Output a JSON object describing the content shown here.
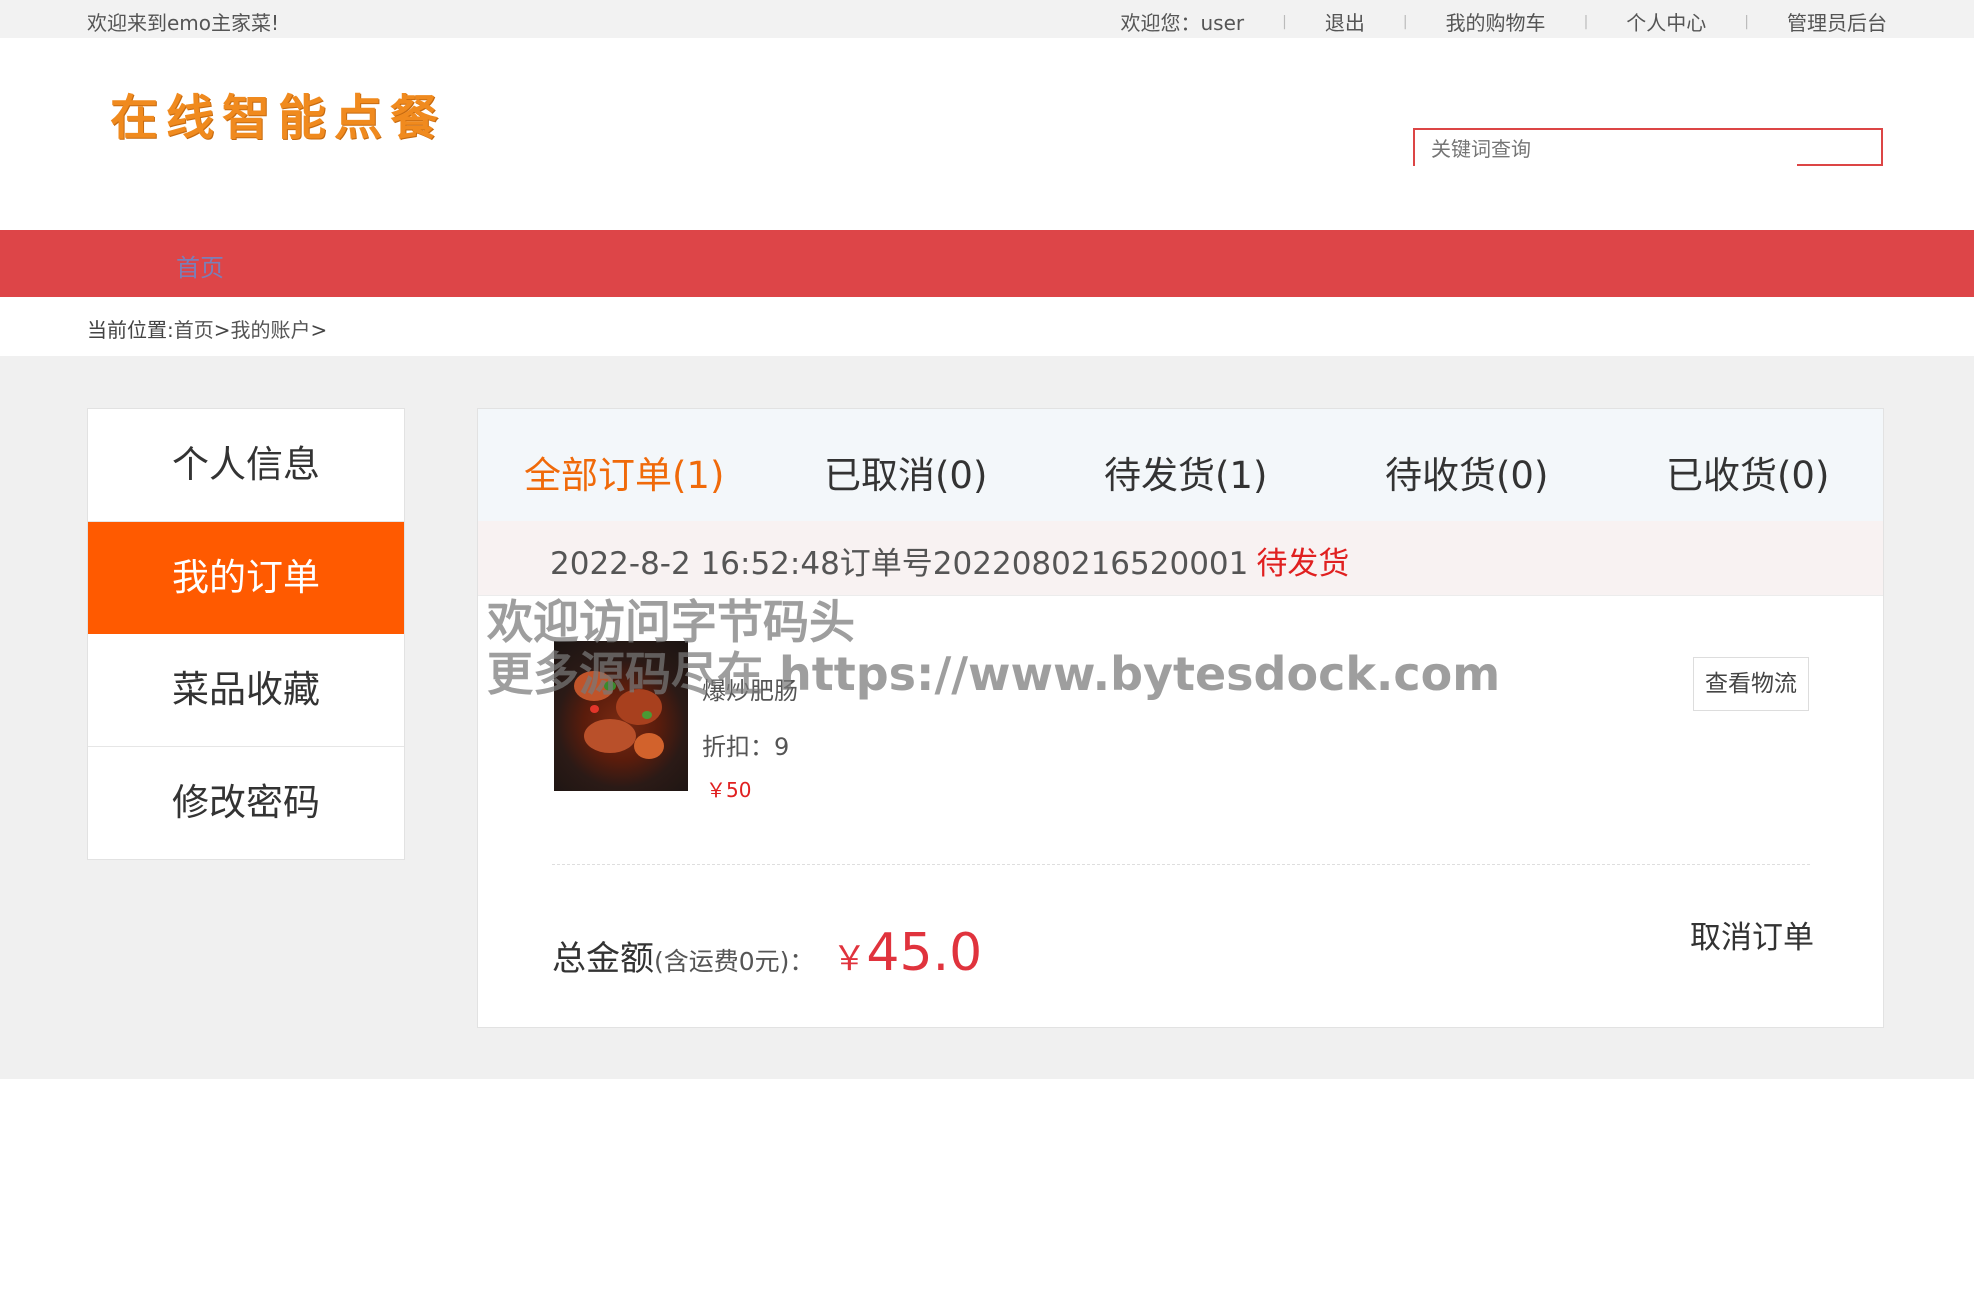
{
  "topbar": {
    "welcome_site": "欢迎来到emo主家菜!",
    "welcome_user": "欢迎您：user",
    "logout": "退出",
    "cart": "我的购物车",
    "profile": "个人中心",
    "admin": "管理员后台"
  },
  "header": {
    "logo_text": "在线智能点餐",
    "search_placeholder": "关键词查询"
  },
  "nav": {
    "home": "首页"
  },
  "breadcrumb": {
    "label": "当前位置:",
    "home": "首页",
    "sep1": ">",
    "account": "我的账户",
    "sep2": ">"
  },
  "sidebar": {
    "items": [
      {
        "label": "个人信息"
      },
      {
        "label": "我的订单"
      },
      {
        "label": "菜品收藏"
      },
      {
        "label": "修改密码"
      }
    ]
  },
  "tabs": [
    {
      "label": "全部订单(1)"
    },
    {
      "label": "已取消(0)"
    },
    {
      "label": "待发货(1)"
    },
    {
      "label": "待收货(0)"
    },
    {
      "label": "已收货(0)"
    }
  ],
  "order": {
    "datetime": "2022-8-2 16:52:48",
    "number_label": "订单号",
    "number": "2022080216520001",
    "status": "待发货",
    "item": {
      "name": "爆炒肥肠",
      "discount": "折扣：9",
      "price": "￥50"
    },
    "logistics": "查看物流",
    "total_label": "总金额",
    "total_note": "(含运费0元)：",
    "currency": "￥",
    "total_amount": "45.0",
    "cancel": "取消订单"
  },
  "watermark": {
    "line1": "欢迎访问字节码头",
    "line2": "更多源码尽在 https://www.bytesdock.com"
  },
  "colors": {
    "nav_red": "#dd4548",
    "active_orange": "#ff5a00",
    "price_red": "#e0333d"
  }
}
